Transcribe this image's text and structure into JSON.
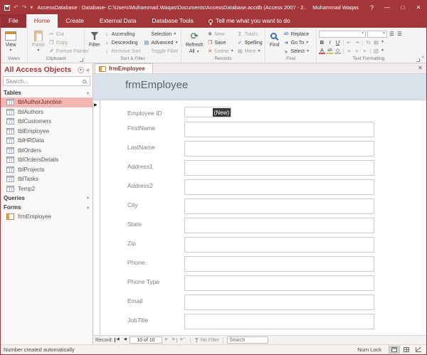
{
  "window": {
    "title": "AccessDatabase : Database- C:\\Users\\Muhammad.Waqas\\Documents\\AccessDatabase.accdb (Access 2007 - 2...",
    "user": "Muhammad Waqas",
    "help": "?",
    "minimize": "—",
    "maximize": "□",
    "close": "✕"
  },
  "tabs": [
    "File",
    "Home",
    "Create",
    "External Data",
    "Database Tools"
  ],
  "tell_me": "Tell me what you want to do",
  "ribbon": {
    "view": "View",
    "views_group": "Views",
    "paste": "Paste",
    "cut": "Cut",
    "copy": "Copy",
    "format_painter": "Format Painter",
    "clipboard_group": "Clipboard",
    "filter": "Filter",
    "ascending": "Ascending",
    "descending": "Descending",
    "remove_sort": "Remove Sort",
    "selection": "Selection",
    "advanced": "Advanced",
    "toggle_filter": "Toggle Filter",
    "sort_filter_group": "Sort & Filter",
    "refresh_line1": "Refresh",
    "refresh_line2": "All",
    "new": "New",
    "save": "Save",
    "delete": "Delete",
    "totals": "Totals",
    "spelling": "Spelling",
    "more": "More",
    "records_group": "Records",
    "find": "Find",
    "replace": "Replace",
    "go_to": "Go To",
    "select": "Select",
    "find_group": "Find",
    "bold": "B",
    "italic": "I",
    "underline": "U",
    "text_formatting_group": "Text Formatting"
  },
  "icons": {
    "cut": "✂",
    "copy": "❐",
    "format_painter": "✐",
    "ascending": "↓",
    "descending": "↓",
    "remove_sort": "↓",
    "advanced": "▤",
    "new": "✱",
    "save": "❒",
    "delete": "✕",
    "totals": "Σ",
    "spelling": "✓",
    "more": "▤",
    "replace": "ab",
    "go_to": "➜",
    "select": "➤",
    "bullet_list": "☰",
    "number_list": "☰",
    "align": "≡",
    "grid": "▦"
  },
  "nav": {
    "title": "All Access Objects",
    "search_placeholder": "Search...",
    "tables_label": "Tables",
    "queries_label": "Queries",
    "forms_label": "Forms",
    "tables": [
      "tblAuthorJunction",
      "tblAuthors",
      "tblCustomers",
      "tblEmployee",
      "tblHRData",
      "tblOrders",
      "tblOrdersDetails",
      "tblProjects",
      "tblTasks",
      "Temp2"
    ],
    "forms": [
      "frmEmployee"
    ]
  },
  "doc": {
    "tab_title": "frmEmployee",
    "form_title": "frmEmployee",
    "fields": [
      {
        "label": "Employee ID",
        "value": "(New)"
      },
      {
        "label": "FirstName",
        "value": ""
      },
      {
        "label": "LastName",
        "value": ""
      },
      {
        "label": "Address1",
        "value": ""
      },
      {
        "label": "Address2",
        "value": ""
      },
      {
        "label": "City",
        "value": ""
      },
      {
        "label": "State",
        "value": ""
      },
      {
        "label": "Zip",
        "value": ""
      },
      {
        "label": "Phone",
        "value": ""
      },
      {
        "label": "Phone Type",
        "value": ""
      },
      {
        "label": "Email",
        "value": ""
      },
      {
        "label": "JobTitle",
        "value": ""
      }
    ]
  },
  "record_nav": {
    "label": "Record:",
    "position": "10 of 10",
    "no_filter": "No Filter",
    "search_placeholder": "Search"
  },
  "status": {
    "message": "Number created automatically",
    "num_lock": "Num Lock"
  },
  "colors": {
    "accent_red": "#A4373A",
    "selected_item_bg": "#F3B8B6",
    "form_header_bg": "#D9E1EA"
  }
}
